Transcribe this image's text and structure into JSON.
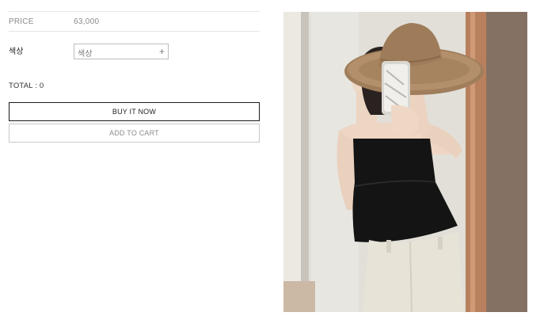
{
  "price": {
    "label": "PRICE",
    "value": "63,000"
  },
  "option": {
    "label": "색상",
    "placeholder": "색상",
    "plus_icon": "+"
  },
  "total": {
    "text": "TOTAL : 0"
  },
  "buttons": {
    "buy_now": "BUY IT NOW",
    "add_to_cart": "ADD TO CART"
  },
  "image": {
    "alt": "product-photo"
  }
}
